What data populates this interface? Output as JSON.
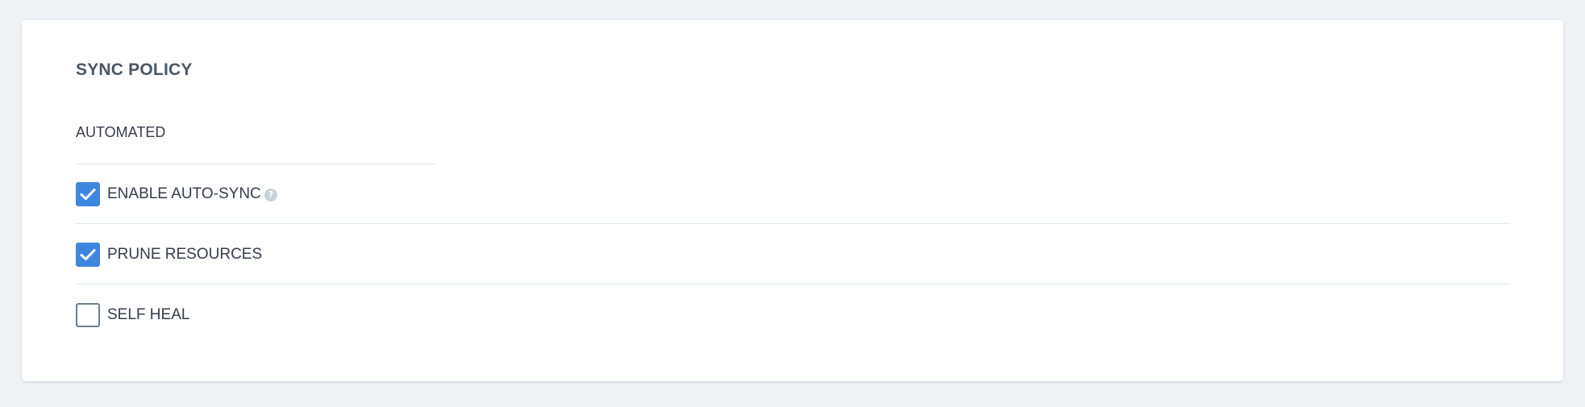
{
  "sync_policy": {
    "title": "SYNC POLICY",
    "mode_label": "AUTOMATED",
    "options": [
      {
        "label": "ENABLE AUTO-SYNC",
        "checked": true,
        "has_help": true,
        "help_glyph": "?"
      },
      {
        "label": "PRUNE RESOURCES",
        "checked": true,
        "has_help": false
      },
      {
        "label": "SELF HEAL",
        "checked": false,
        "has_help": false
      }
    ]
  },
  "colors": {
    "accent": "#3f86e0",
    "background": "#eef2f5",
    "panel": "#ffffff",
    "divider": "#dee6eb",
    "text": "#363c4a",
    "title_text": "#495763",
    "help_icon": "#c8d3dc",
    "unchecked_border": "#6d7f8b"
  },
  "icons": {
    "checkmark": "check-icon",
    "help": "help-circle-icon"
  }
}
